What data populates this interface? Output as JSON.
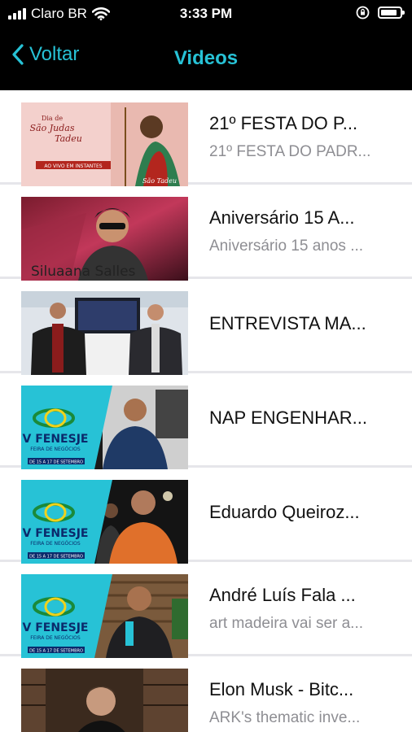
{
  "status_bar": {
    "carrier": "Claro BR",
    "time": "3:33 PM",
    "icons": [
      "cellular-signal-icon",
      "wifi-icon",
      "orientation-lock-icon",
      "battery-icon"
    ],
    "battery_level": 0.85
  },
  "nav": {
    "back_label": "Voltar",
    "title": "Videos",
    "accent_color": "#27c2d6"
  },
  "videos": [
    {
      "title": "21º FESTA DO P...",
      "subtitle": "21º FESTA DO PADR...",
      "thumb_text": [
        "Dia de",
        "São Judas",
        "Tadeu",
        "AO VIVO EM INSTANTES",
        "São Tadeu"
      ]
    },
    {
      "title": "Aniversário 15 A...",
      "subtitle": "Aniversário 15 anos ...",
      "thumb_text": [
        "Siluaana Salles"
      ]
    },
    {
      "title": "ENTREVISTA MA...",
      "subtitle": "",
      "thumb_text": []
    },
    {
      "title": "NAP ENGENHAR...",
      "subtitle": "",
      "thumb_text": [
        "V FENESJE",
        "FEIRA DE NEGÓCIOS",
        "DE 15 A 17 DE SETEMBRO"
      ]
    },
    {
      "title": "Eduardo Queiroz...",
      "subtitle": "",
      "thumb_text": [
        "V FENESJE",
        "FEIRA DE NEGÓCIOS",
        "DE 15 A 17 DE SETEMBRO"
      ]
    },
    {
      "title": "André Luís Fala ...",
      "subtitle": "art madeira vai ser a...",
      "thumb_text": [
        "V FENESJE",
        "FEIRA DE NEGÓCIOS",
        "DE 15 A 17 DE SETEMBRO"
      ]
    },
    {
      "title": "Elon Musk - Bitc...",
      "subtitle": "ARK's thematic inve...",
      "thumb_text": []
    }
  ]
}
